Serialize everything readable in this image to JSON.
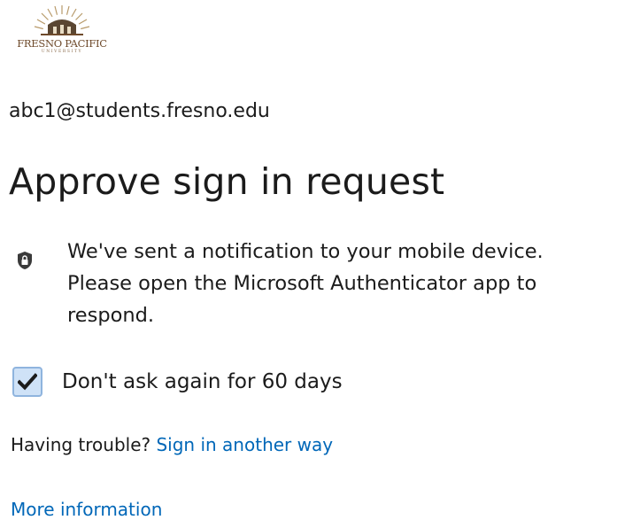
{
  "logo": {
    "name": "FRESNO PACIFIC",
    "subtitle": "UNIVERSITY"
  },
  "identity": {
    "email": "abc1@students.fresno.edu"
  },
  "title": "Approve sign in request",
  "notice": {
    "icon": "lock-icon",
    "line1": "We've sent a notification to your mobile device.",
    "line2": "Please open the Microsoft Authenticator app to",
    "line3": "respond."
  },
  "remember": {
    "checked": true,
    "label": "Don't ask again for 60 days"
  },
  "help": {
    "trouble_text": "Having trouble?",
    "other_way_link": "Sign in another way",
    "more_info_link": "More information"
  },
  "colors": {
    "link": "#0067b8",
    "text": "#1b1b1b",
    "checkbox_fill": "#cfe2f7",
    "checkbox_border": "#8fb4de",
    "logo_brown": "#6e4a2b"
  }
}
